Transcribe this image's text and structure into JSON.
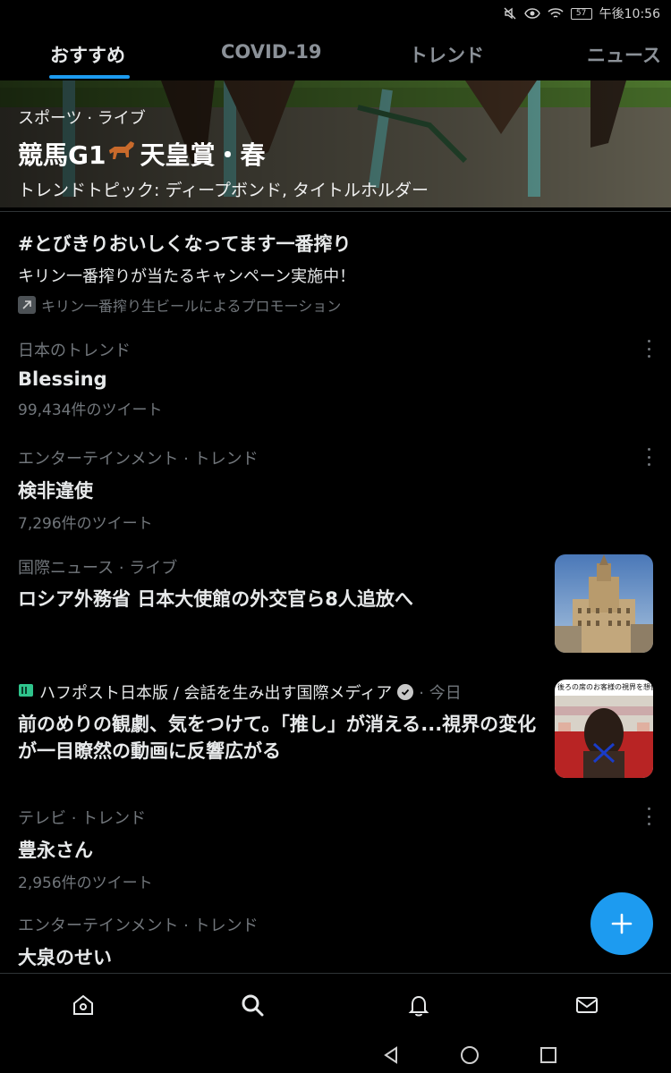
{
  "status_bar": {
    "battery": "57",
    "time": "午後10:56"
  },
  "tabs": [
    {
      "label": "おすすめ",
      "active": true
    },
    {
      "label": "COVID-19",
      "active": false
    },
    {
      "label": "トレンド",
      "active": false
    },
    {
      "label": "ニュース",
      "active": false
    }
  ],
  "hero": {
    "category": "スポーツ · ライブ",
    "title_pre": "競馬G1",
    "title_post": "天皇賞・春",
    "subtitle": "トレンドトピック: ディープボンド, タイトルホルダー"
  },
  "promoted": {
    "title": "#とびきりおいしくなってます一番搾り",
    "description": "キリン一番搾りが当たるキャンペーン実施中！",
    "promoted_by": "キリン一番搾り生ビールによるプロモーション"
  },
  "trends": [
    {
      "meta": "日本のトレンド",
      "title": "Blessing",
      "count": "99,434件のツイート"
    },
    {
      "meta": "エンターテインメント · トレンド",
      "title": "検非違使",
      "count": "7,296件のツイート"
    },
    {
      "meta": "テレビ · トレンド",
      "title": "豊永さん",
      "count": "2,956件のツイート"
    },
    {
      "meta": "エンターテインメント · トレンド",
      "title": "大泉のせい",
      "count": ""
    }
  ],
  "news": [
    {
      "meta": "国際ニュース · ライブ",
      "title": "ロシア外務省 日本大使館の外交官ら8人追放へ"
    },
    {
      "source": "ハフポスト日本版 / 会話を生み出す国際メディア",
      "time": "· 今日",
      "title": "前のめりの観劇、気をつけて。「推し」が消える...視界の変化が一目瞭然の動画に反響広がる",
      "thumb_caption": "後ろの席のお客様の視界を想像以上"
    }
  ],
  "colors": {
    "accent": "#1d9bf0",
    "background": "#000000",
    "muted": "#71767b"
  },
  "icons": [
    "home-icon",
    "search-icon",
    "bell-icon",
    "mail-icon",
    "compose-plus-icon"
  ]
}
